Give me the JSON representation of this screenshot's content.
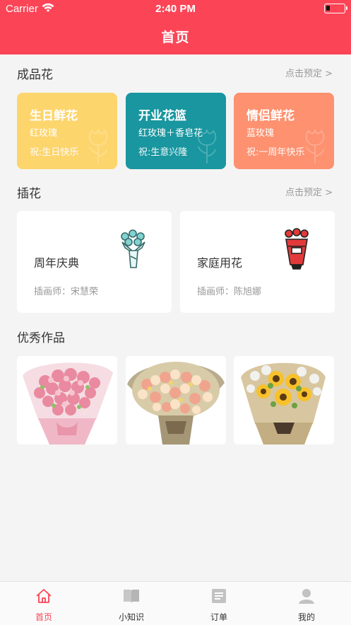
{
  "status_bar": {
    "carrier": "Carrier",
    "time": "2:40 PM"
  },
  "header": {
    "title": "首页"
  },
  "finished": {
    "title": "成品花",
    "more": "点击预定 >",
    "cards": [
      {
        "name": "生日鲜花",
        "flower": "红玫瑰",
        "wish": "祝:生日快乐",
        "color": "#fdd56d"
      },
      {
        "name": "开业花篮",
        "flower": "红玫瑰＋香皂花",
        "wish": "祝:生意兴隆",
        "color": "#19969f"
      },
      {
        "name": "情侣鲜花",
        "flower": "蓝玫瑰",
        "wish": "祝:一周年快乐",
        "color": "#fd9170"
      }
    ]
  },
  "arrangement": {
    "title": "插花",
    "more": "点击预定 >",
    "cards": [
      {
        "name": "周年庆典",
        "artist": "插画师：宋慧荣"
      },
      {
        "name": "家庭用花",
        "artist": "插画师：陈旭娜"
      }
    ]
  },
  "works": {
    "title": "优秀作品"
  },
  "tabbar": [
    {
      "label": "首页",
      "icon": "home-icon",
      "active": true
    },
    {
      "label": "小知识",
      "icon": "book-icon",
      "active": false
    },
    {
      "label": "订单",
      "icon": "order-icon",
      "active": false
    },
    {
      "label": "我的",
      "icon": "user-icon",
      "active": false
    }
  ],
  "colors": {
    "brand": "#fb4557",
    "muted": "#999999",
    "background": "#f4f4f4"
  }
}
